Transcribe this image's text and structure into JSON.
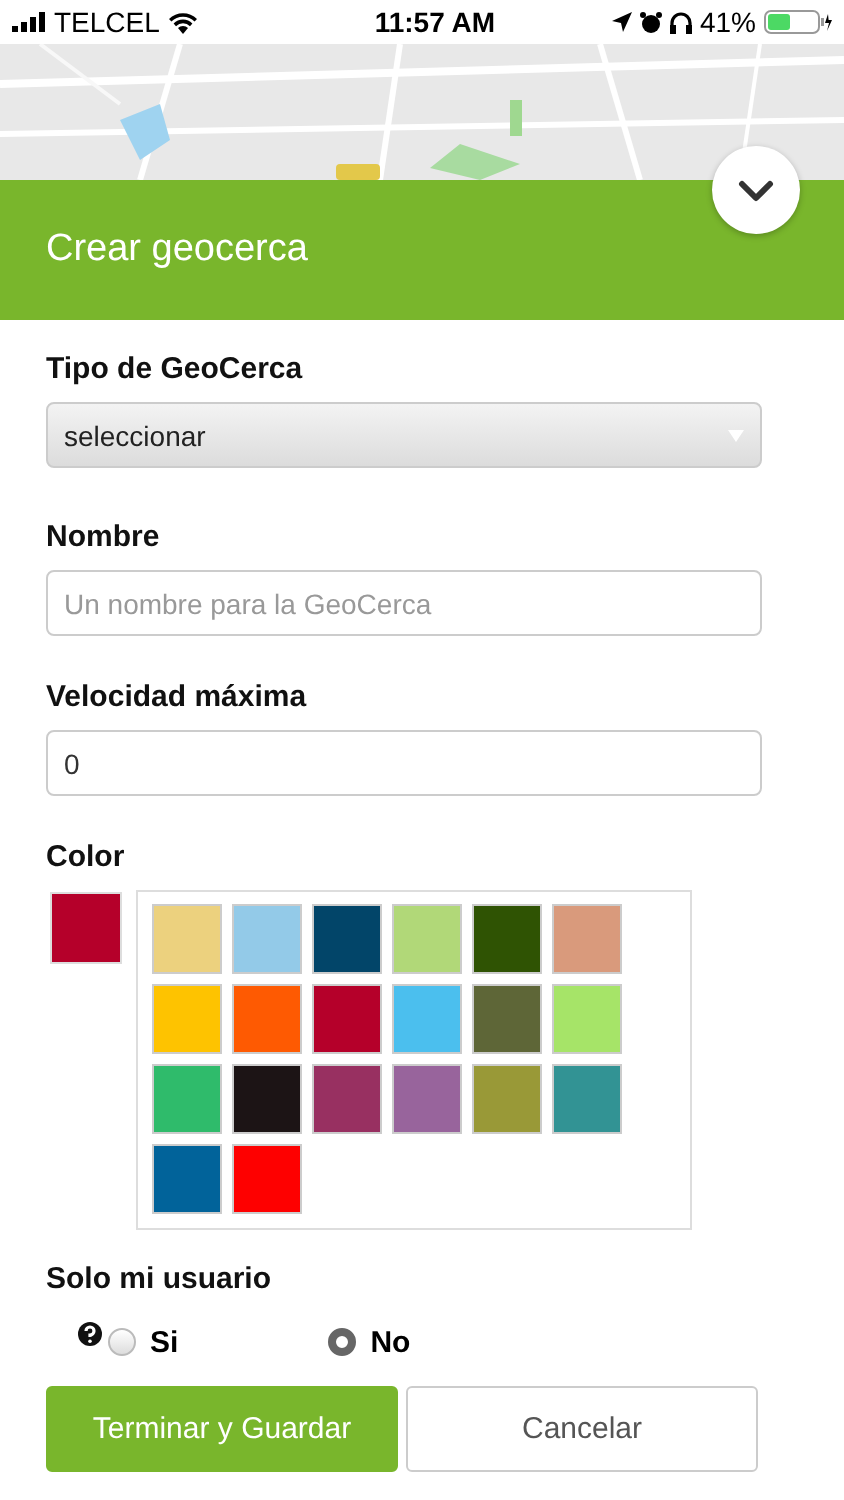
{
  "status_bar": {
    "carrier": "TELCEL",
    "time": "11:57 AM",
    "battery": "41%"
  },
  "header": {
    "title": "Crear geocerca"
  },
  "form": {
    "type_label": "Tipo de GeoCerca",
    "type_value": "seleccionar",
    "name_label": "Nombre",
    "name_placeholder": "Un nombre para la GeoCerca",
    "speed_label": "Velocidad máxima",
    "speed_value": "0",
    "color_label": "Color",
    "current_swatch": {
      "color": "#b5002a"
    },
    "palette": [
      {
        "color": "#ecd17e"
      },
      {
        "color": "#93cae8"
      },
      {
        "color": "#024569"
      },
      {
        "color": "#b1d878"
      },
      {
        "color": "#2f5303"
      },
      {
        "color": "#d99a7c"
      },
      {
        "color": "#fec300"
      },
      {
        "color": "#fe5a02"
      },
      {
        "color": "#b5002a"
      },
      {
        "color": "#4bbfee"
      },
      {
        "color": "#5e6637"
      },
      {
        "color": "#a6e468"
      },
      {
        "color": "#2fbb6b"
      },
      {
        "color": "#1c1415"
      },
      {
        "color": "#983061"
      },
      {
        "color": "#98649c"
      },
      {
        "color": "#999937"
      },
      {
        "color": "#329394"
      },
      {
        "color": "#01639a"
      },
      {
        "color": "#fe0000"
      }
    ],
    "only_user_label": "Solo mi usuario",
    "radios": [
      {
        "label": "Si",
        "selected": false
      },
      {
        "label": "No",
        "selected": true
      }
    ]
  },
  "buttons": [
    {
      "label": "Terminar y Guardar",
      "kind": "primary"
    },
    {
      "label": "Cancelar",
      "kind": "secondary"
    }
  ]
}
